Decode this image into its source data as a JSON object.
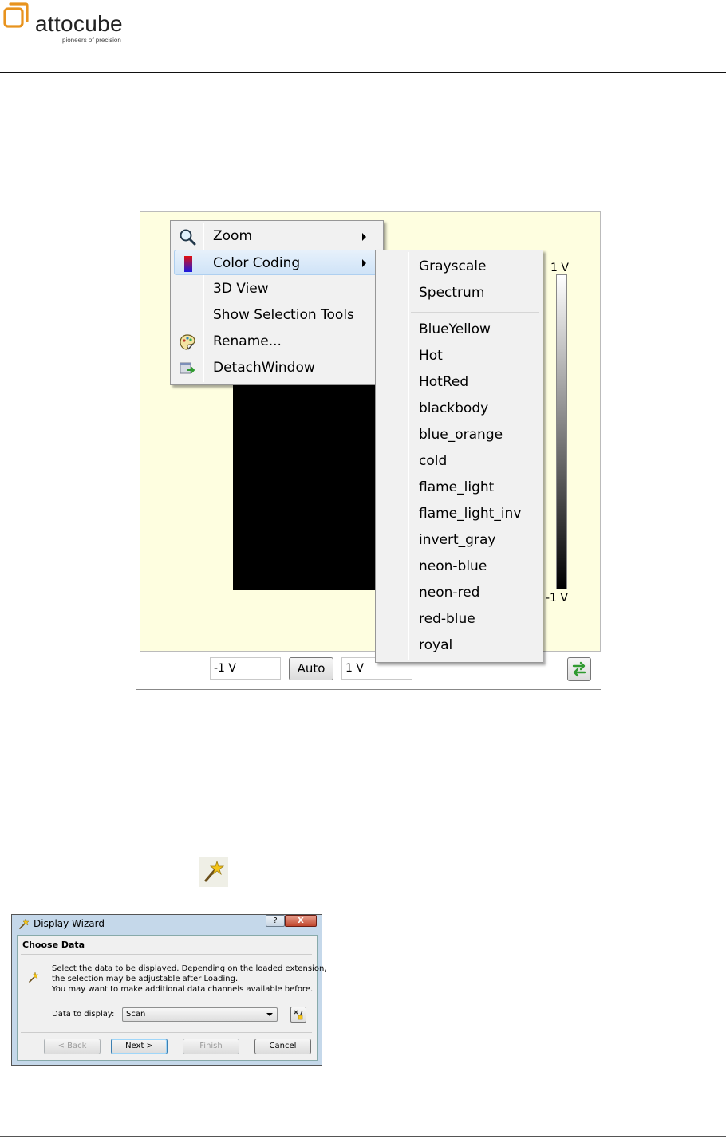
{
  "header": {
    "logo_text": "attocube",
    "logo_tagline": "pioneers of precision",
    "brand_color": "#E8931E"
  },
  "plot_window": {
    "colorbar_max": "1 V",
    "colorbar_min": "-1 V",
    "min_value": "-1 V",
    "auto_label": "Auto",
    "max_value": "1 V",
    "background_color": "#FEFEE0"
  },
  "context_menu": {
    "items": [
      {
        "label": "Zoom",
        "icon": "magnifier-icon",
        "submenu": true
      },
      {
        "label": "Color Coding",
        "icon": "color-gradient-icon",
        "submenu": true
      },
      {
        "label": "3D View",
        "icon": "",
        "submenu": false
      },
      {
        "label": "Show Selection Tools",
        "icon": "",
        "submenu": false
      },
      {
        "label": "Rename...",
        "icon": "palette-icon",
        "submenu": false
      },
      {
        "label": "DetachWindow",
        "icon": "detach-window-icon",
        "submenu": false
      }
    ]
  },
  "color_submenu": {
    "group1": [
      "Grayscale",
      "Spectrum"
    ],
    "group2": [
      "BlueYellow",
      "Hot",
      "HotRed",
      "blackbody",
      "blue_orange",
      "cold",
      "flame_light",
      "flame_light_inv",
      "invert_gray",
      "neon-blue",
      "neon-red",
      "red-blue",
      "royal"
    ]
  },
  "wizard_icon": "magic-wand-icon",
  "dialog": {
    "title": "Display Wizard",
    "help": "?",
    "close": "X",
    "heading": "Choose Data",
    "description": [
      "Select the data to be displayed. Depending on the loaded extension,",
      "the selection may be adjustable after Loading.",
      "You may want to make additional data channels available before."
    ],
    "field_label": "Data to display:",
    "field_value": "Scan",
    "buttons": {
      "back": "< Back",
      "next": "Next >",
      "finish": "Finish",
      "cancel": "Cancel"
    }
  }
}
